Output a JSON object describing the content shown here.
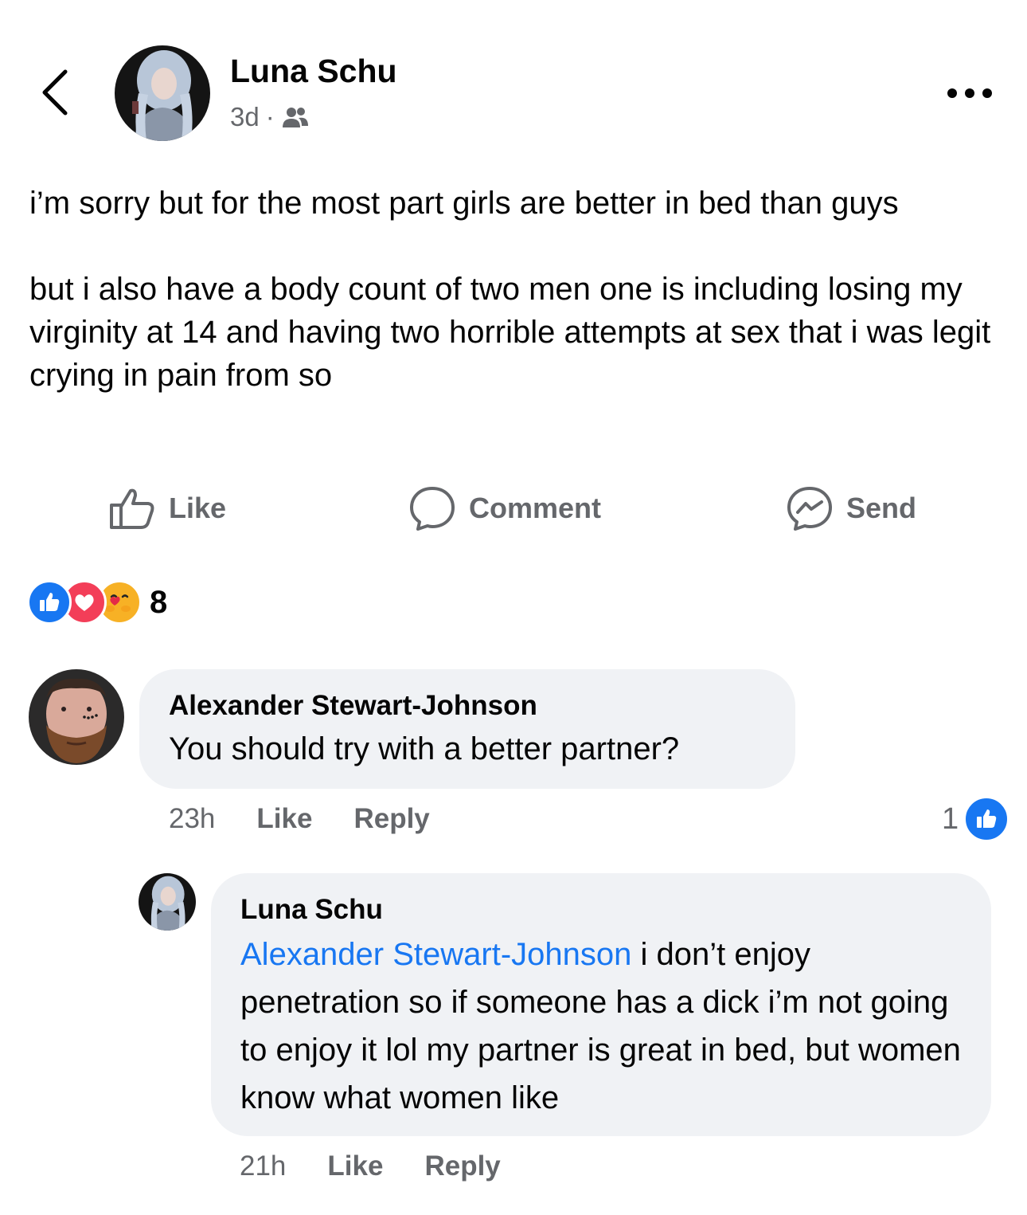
{
  "header": {
    "author": "Luna Schu",
    "time": "3d",
    "separator": "·",
    "audience_icon": "friends-icon"
  },
  "post": {
    "paragraphs": [
      "i’m sorry but for the most part girls are better in bed than guys",
      "but i also have a body count of two men one is including losing my virginity at 14 and having two horrible attempts at sex that i was legit crying in pain from so"
    ]
  },
  "actions": {
    "like": "Like",
    "comment": "Comment",
    "send": "Send"
  },
  "reactions": {
    "icons": [
      "like-reaction-icon",
      "love-reaction-icon",
      "care-reaction-icon"
    ],
    "count": "8"
  },
  "comments": [
    {
      "author": "Alexander Stewart-Johnson",
      "text": "You should try with a better partner?",
      "time": "23h",
      "like_label": "Like",
      "reply_label": "Reply",
      "like_count": "1"
    }
  ],
  "replies": [
    {
      "author": "Luna Schu",
      "mention": "Alexander Stewart-Johnson",
      "text": " i don’t enjoy penetration so if someone has a dick i’m not going to enjoy it lol my partner is great in bed, but women know what women like",
      "time": "21h",
      "like_label": "Like",
      "reply_label": "Reply"
    }
  ],
  "colors": {
    "link_blue": "#1877f2",
    "secondary_text": "#65676b",
    "bubble_bg": "#f0f2f5",
    "love_red": "#f33e58"
  }
}
